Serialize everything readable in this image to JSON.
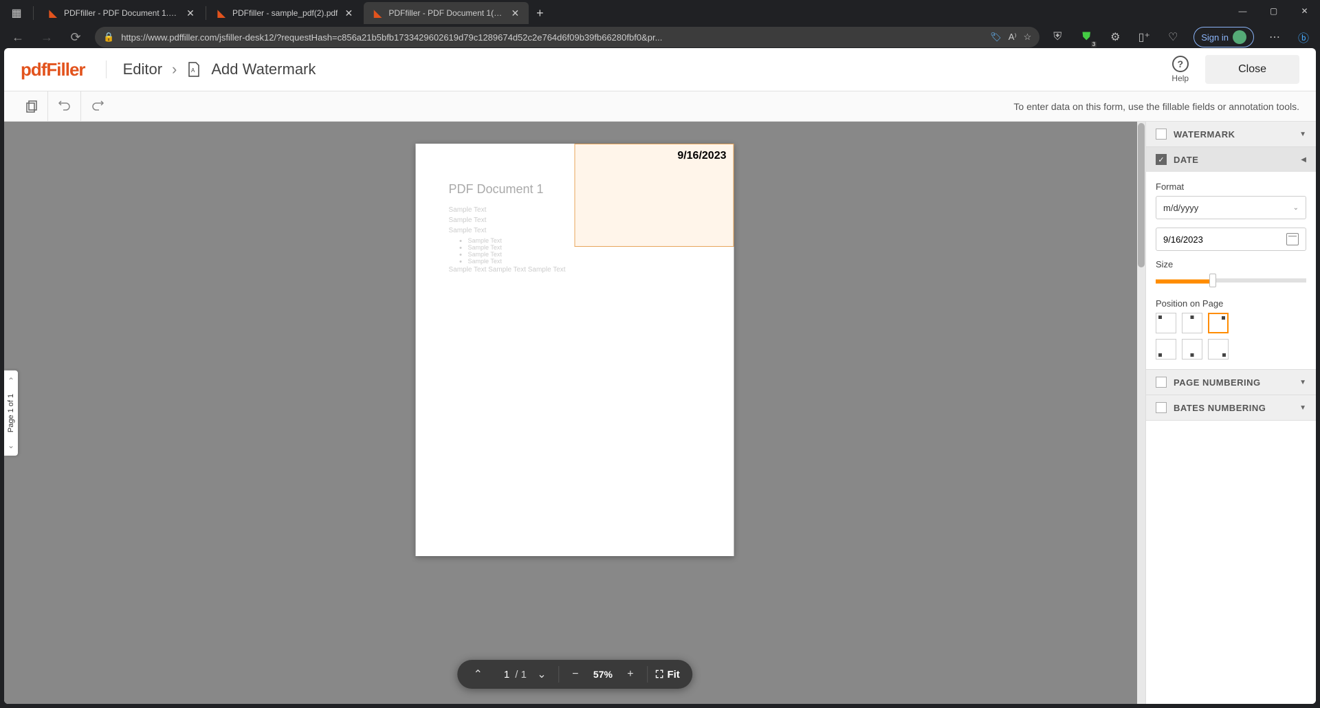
{
  "browser": {
    "tabs": [
      {
        "title": "PDFfiller - PDF Document 1.pdf",
        "active": false
      },
      {
        "title": "PDFfiller - sample_pdf(2).pdf",
        "active": false
      },
      {
        "title": "PDFfiller - PDF Document 1(1).pd",
        "active": true
      }
    ],
    "url": "https://www.pdffiller.com/jsfiller-desk12/?requestHash=c856a21b5bfb1733429602619d79c1289674d52c2e764d6f09b39fb66280fbf0&pr...",
    "signin": "Sign in",
    "ext_badge": "3"
  },
  "header": {
    "logo": "pdfFiller",
    "breadcrumb_root": "Editor",
    "breadcrumb_current": "Add Watermark",
    "help": "Help",
    "close": "Close"
  },
  "toolbar": {
    "hint": "To enter data on this form, use the fillable fields or annotation tools."
  },
  "page_nav": {
    "label": "Page 1 of 1"
  },
  "document": {
    "title": "PDF Document 1",
    "lines": [
      "Sample Text",
      "Sample Text",
      "Sample Text"
    ],
    "bullets": [
      "Sample Text",
      "Sample Text",
      "Sample Text",
      "Sample Text"
    ],
    "footer": "Sample Text Sample Text Sample Text",
    "watermark_value": "9/16/2023"
  },
  "zoom": {
    "page_current": "1",
    "page_total": "/ 1",
    "percent": "57%",
    "fit": "Fit"
  },
  "panel": {
    "watermark": {
      "title": "WATERMARK",
      "checked": false
    },
    "date": {
      "title": "DATE",
      "checked": true,
      "format_label": "Format",
      "format_value": "m/d/yyyy",
      "date_value": "9/16/2023",
      "size_label": "Size",
      "size_percent": 38,
      "position_label": "Position on Page",
      "position_selected": "top-right"
    },
    "page_numbering": {
      "title": "PAGE NUMBERING",
      "checked": false
    },
    "bates_numbering": {
      "title": "BATES NUMBERING",
      "checked": false
    }
  }
}
